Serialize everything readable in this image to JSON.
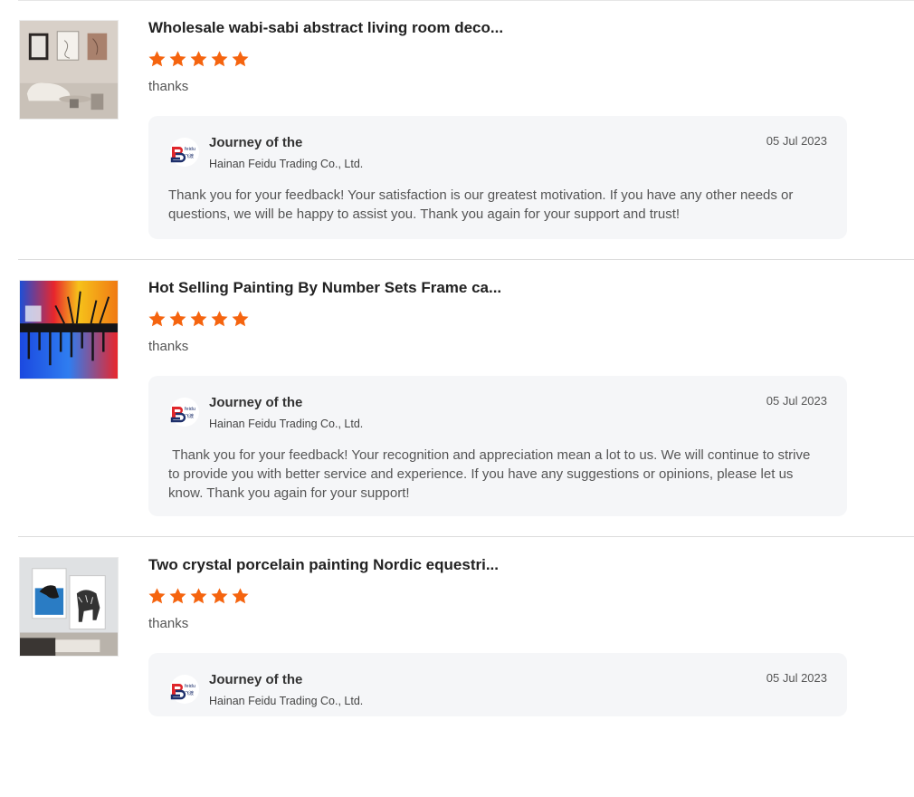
{
  "reviews": [
    {
      "title": "Wholesale wabi-sabi abstract living room deco...",
      "rating": 5,
      "comment": "thanks",
      "reply": {
        "name": "Journey of the",
        "company": "Hainan Feidu Trading Co., Ltd.",
        "date": "05 Jul 2023",
        "text": "Thank you for your feedback! Your satisfaction is our greatest motivation. If you have any other needs or questions, we will be happy to assist you. Thank you again for your support and trust!"
      }
    },
    {
      "title": "Hot Selling Painting By Number Sets Frame ca...",
      "rating": 5,
      "comment": "thanks",
      "reply": {
        "name": "Journey of the",
        "company": "Hainan Feidu Trading Co., Ltd.",
        "date": "05 Jul 2023",
        "text": " Thank you for your feedback! Your recognition and appreciation mean a lot to us. We will continue to strive to provide you with better service and experience. If you have any suggestions or opinions, please let us know. Thank you again for your support!"
      }
    },
    {
      "title": "Two crystal porcelain painting Nordic equestri...",
      "rating": 5,
      "comment": "thanks",
      "reply": {
        "name": "Journey of the",
        "company": "Hainan Feidu Trading Co., Ltd.",
        "date": "05 Jul 2023",
        "text": ""
      }
    }
  ],
  "logo": {
    "brand_text": "feidu",
    "brand_sub": "飞渡"
  },
  "colors": {
    "star": "#f5640f",
    "reply_bg": "#f5f6f8",
    "logo_red": "#e0262b",
    "logo_navy": "#1d2f6b"
  }
}
